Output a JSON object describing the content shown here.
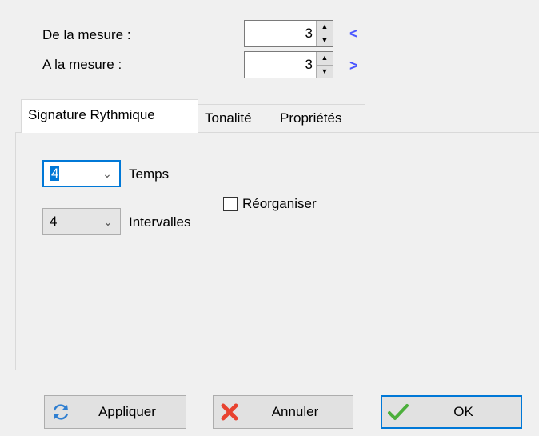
{
  "range": {
    "from_label": "De la mesure :",
    "from_value": "3",
    "from_nav": "<",
    "to_label": "A la mesure :",
    "to_value": "3",
    "to_nav": ">"
  },
  "tabs": [
    {
      "label": "Signature Rythmique",
      "active": true
    },
    {
      "label": "Tonalité",
      "active": false
    },
    {
      "label": "Propriétés",
      "active": false
    }
  ],
  "signature": {
    "beats_value": "4",
    "beats_label": "Temps",
    "unit_value": "4",
    "unit_label": "Intervalles",
    "reorganize_label": "Réorganiser",
    "reorganize_checked": false
  },
  "buttons": {
    "apply": "Appliquer",
    "cancel": "Annuler",
    "ok": "OK"
  },
  "colors": {
    "accent": "#0078d7",
    "nav_arrow": "#4a56ff",
    "cancel_icon": "#e8422f",
    "ok_icon": "#4caf3c",
    "apply_icon": "#2f7fd1"
  },
  "icons": {
    "apply": "refresh-icon",
    "cancel": "cross-icon",
    "ok": "checkmark-icon"
  }
}
